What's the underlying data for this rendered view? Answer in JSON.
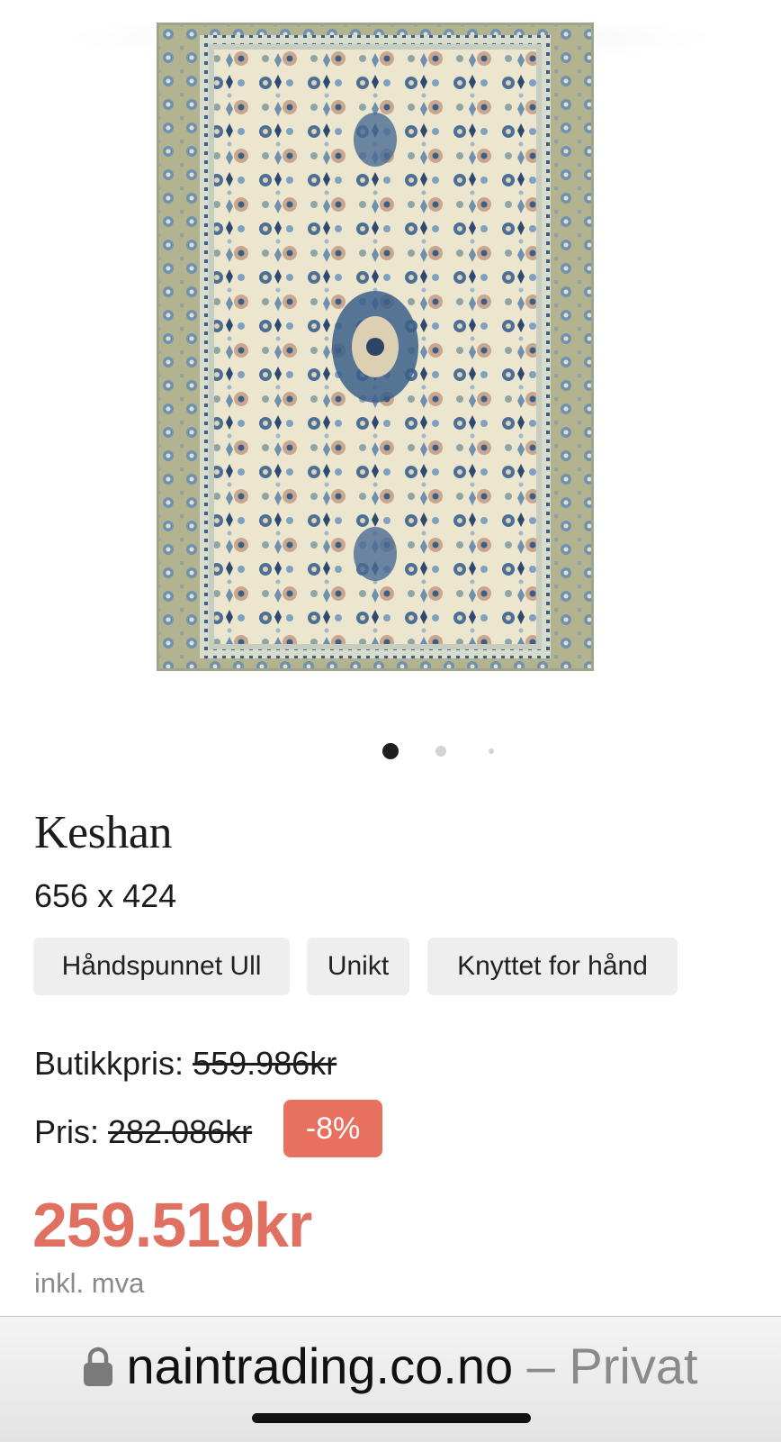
{
  "product": {
    "name": "Keshan",
    "dimensions": "656 x 424",
    "tags": [
      "Håndspunnet Ull",
      "Unikt",
      "Knyttet for hånd"
    ],
    "store_price_label": "Butikkpris:",
    "store_price": "559.986kr",
    "price_label": "Pris:",
    "price": "282.086kr",
    "discount_badge": "-8%",
    "sale_price": "259.519kr",
    "vat_note": "inkl. mva"
  },
  "gallery": {
    "image_icon": "persian-rug-photo",
    "dot_count": 3,
    "active_index": 0
  },
  "browser": {
    "lock_icon": "lock-icon",
    "domain": "naintrading.co.no",
    "separator": "–",
    "mode": "Privat"
  },
  "colors": {
    "accent": "#e07060",
    "badge_bg": "#e8705f",
    "tag_bg": "#eeeeee",
    "muted_text": "#8a8a8a"
  }
}
